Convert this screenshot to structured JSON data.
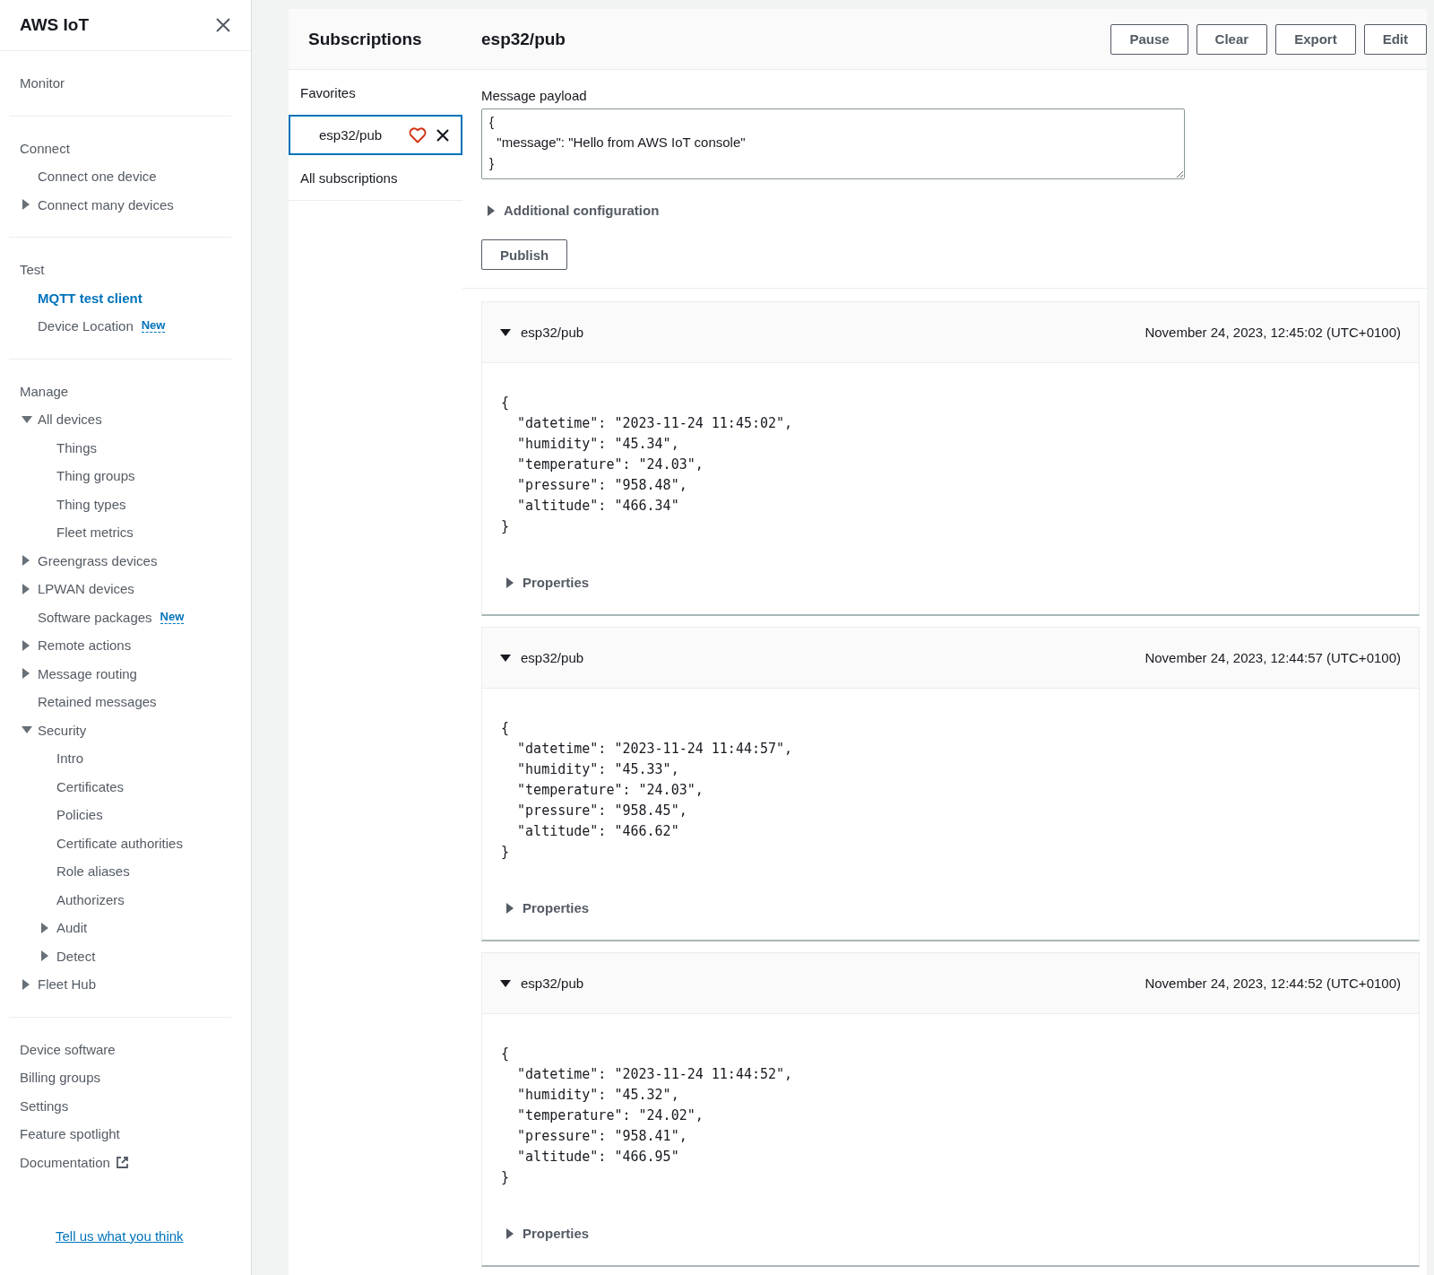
{
  "sidebar": {
    "title": "AWS IoT",
    "sections": [
      {
        "heading": "Monitor"
      },
      {
        "heading": "Connect",
        "items": [
          {
            "label": "Connect one device"
          },
          {
            "label": "Connect many devices",
            "expanded": false
          }
        ]
      },
      {
        "heading": "Test",
        "items": [
          {
            "label": "MQTT test client",
            "selected": true
          },
          {
            "label": "Device Location",
            "badge": "New"
          }
        ]
      },
      {
        "heading": "Manage",
        "items": [
          {
            "label": "All devices",
            "expanded": true,
            "children": [
              {
                "label": "Things"
              },
              {
                "label": "Thing groups"
              },
              {
                "label": "Thing types"
              },
              {
                "label": "Fleet metrics"
              }
            ]
          },
          {
            "label": "Greengrass devices",
            "expanded": false
          },
          {
            "label": "LPWAN devices",
            "expanded": false
          },
          {
            "label": "Software packages",
            "badge": "New"
          },
          {
            "label": "Remote actions",
            "expanded": false
          },
          {
            "label": "Message routing",
            "expanded": false
          },
          {
            "label": "Retained messages"
          },
          {
            "label": "Security",
            "expanded": true,
            "children": [
              {
                "label": "Intro"
              },
              {
                "label": "Certificates"
              },
              {
                "label": "Policies"
              },
              {
                "label": "Certificate authorities"
              },
              {
                "label": "Role aliases"
              },
              {
                "label": "Authorizers"
              },
              {
                "label": "Audit",
                "expanded": false
              },
              {
                "label": "Detect",
                "expanded": false
              }
            ]
          },
          {
            "label": "Fleet Hub",
            "expanded": false
          }
        ]
      },
      {
        "items": [
          {
            "label": "Device software"
          },
          {
            "label": "Billing groups"
          },
          {
            "label": "Settings"
          },
          {
            "label": "Feature spotlight"
          },
          {
            "label": "Documentation",
            "external": true
          }
        ]
      }
    ],
    "feedback_link": "Tell us what you think"
  },
  "subscriptions": {
    "title": "Subscriptions",
    "favorites_label": "Favorites",
    "favorites": [
      {
        "topic": "esp32/pub",
        "selected": true,
        "favorite": true
      }
    ],
    "all_label": "All subscriptions"
  },
  "topic_view": {
    "title": "esp32/pub",
    "buttons": [
      "Pause",
      "Clear",
      "Export",
      "Edit"
    ],
    "payload_label": "Message payload",
    "payload_value": "{\n  \"message\": \"Hello from AWS IoT console\"\n}",
    "additional_config": "Additional configuration",
    "publish_button": "Publish",
    "messages": [
      {
        "topic": "esp32/pub",
        "expanded": true,
        "time": "November 24, 2023, 12:45:02 (UTC+0100)",
        "payload": "{\n  \"datetime\": \"2023-11-24 11:45:02\",\n  \"humidity\": \"45.34\",\n  \"temperature\": \"24.03\",\n  \"pressure\": \"958.48\",\n  \"altitude\": \"466.34\"\n}",
        "properties": "Properties"
      },
      {
        "topic": "esp32/pub",
        "expanded": true,
        "time": "November 24, 2023, 12:44:57 (UTC+0100)",
        "payload": "{\n  \"datetime\": \"2023-11-24 11:44:57\",\n  \"humidity\": \"45.33\",\n  \"temperature\": \"24.03\",\n  \"pressure\": \"958.45\",\n  \"altitude\": \"466.62\"\n}",
        "properties": "Properties"
      },
      {
        "topic": "esp32/pub",
        "expanded": true,
        "time": "November 24, 2023, 12:44:52 (UTC+0100)",
        "payload": "{\n  \"datetime\": \"2023-11-24 11:44:52\",\n  \"humidity\": \"45.32\",\n  \"temperature\": \"24.02\",\n  \"pressure\": \"958.41\",\n  \"altitude\": \"466.95\"\n}",
        "properties": "Properties"
      }
    ]
  }
}
